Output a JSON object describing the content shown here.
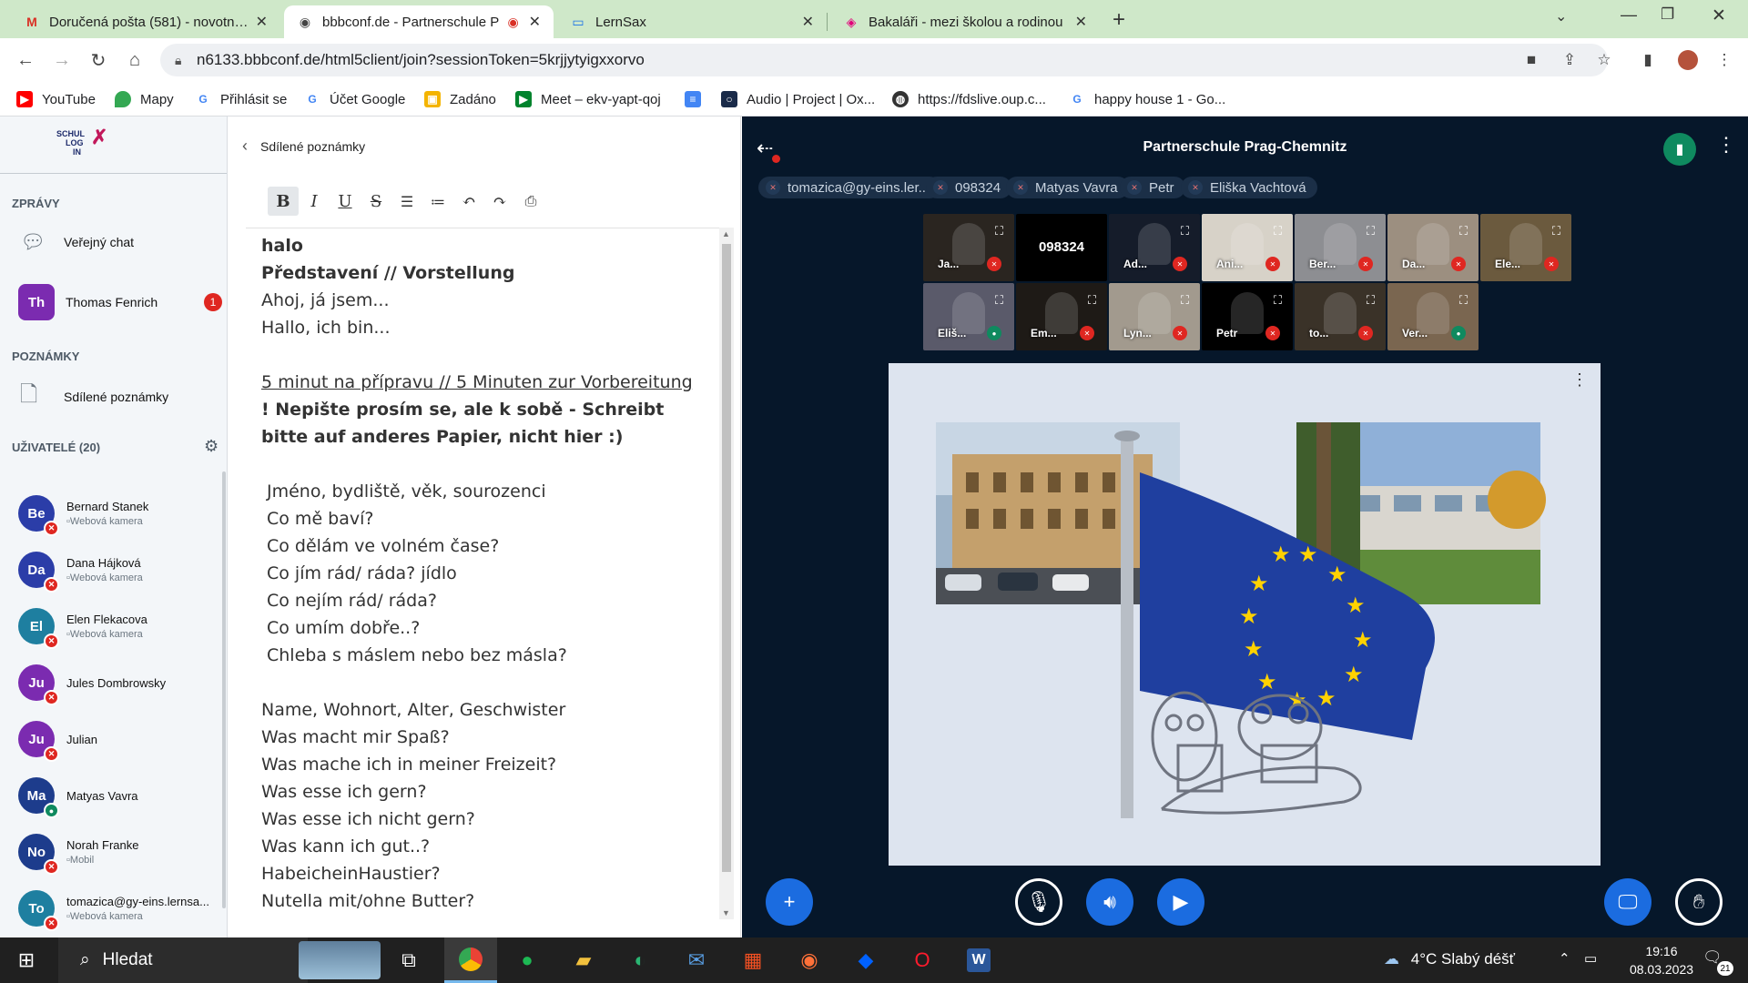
{
  "browser": {
    "tabs": [
      {
        "title": "Doručená pošta (581) - novotna.j",
        "icon": "gmail-icon"
      },
      {
        "title": "bbbconf.de - Partnerschule P",
        "icon": "bbb-icon",
        "active": true
      },
      {
        "title": "LernSax",
        "icon": "laptop-icon"
      },
      {
        "title": "Bakaláři - mezi školou a rodinou",
        "icon": "bakalari-icon"
      }
    ],
    "url": "n6133.bbbconf.de/html5client/join?sessionToken=5krjjytyigxxorvo",
    "bookmarks": [
      {
        "label": "YouTube",
        "icon": "youtube-icon",
        "color": "#ff0000"
      },
      {
        "label": "Mapy",
        "icon": "maps-icon",
        "color": "#34a853"
      },
      {
        "label": "Přihlásit se",
        "icon": "google-icon",
        "color": "#4285f4"
      },
      {
        "label": "Účet Google",
        "icon": "google-icon",
        "color": "#4285f4"
      },
      {
        "label": "Zadáno",
        "icon": "classroom-icon",
        "color": "#f4b400"
      },
      {
        "label": "Meet – ekv-yapt-qoj",
        "icon": "meet-icon",
        "color": "#00832d"
      },
      {
        "label": "Audio | Project | Ox...",
        "icon": "oxford-icon",
        "color": "#1a2b49"
      },
      {
        "label": "https://fdslive.oup.c...",
        "icon": "globe-icon",
        "color": "#333333"
      },
      {
        "label": "happy house 1 - Go...",
        "icon": "google-icon",
        "color": "#4285f4"
      }
    ]
  },
  "sidebar": {
    "logo_lines": [
      "SCHUL",
      "LOG",
      "IN"
    ],
    "messages_header": "ZPRÁVY",
    "public_chat": "Veřejný chat",
    "private_chat": {
      "initials": "Th",
      "name": "Thomas Fenrich",
      "unread": "1"
    },
    "notes_header": "POZNÁMKY",
    "shared_notes": "Sdílené poznámky",
    "users_header": "UŽIVATELÉ (20)",
    "users": [
      {
        "initials": "Be",
        "name": "Bernard Stanek",
        "sub": "Webová kamera",
        "color": "#2b3da8",
        "mic": "muted"
      },
      {
        "initials": "Da",
        "name": "Dana Hájková",
        "sub": "Webová kamera",
        "color": "#2b3da8",
        "mic": "muted"
      },
      {
        "initials": "El",
        "name": "Elen Flekacova",
        "sub": "Webová kamera",
        "color": "#1e7fa0",
        "mic": "muted"
      },
      {
        "initials": "Ju",
        "name": "Jules Dombrowsky",
        "sub": "",
        "color": "#7b2bb0",
        "mic": "muted"
      },
      {
        "initials": "Ju",
        "name": "Julian",
        "sub": "",
        "color": "#7b2bb0",
        "mic": "muted"
      },
      {
        "initials": "Ma",
        "name": "Matyas Vavra",
        "sub": "",
        "color": "#1d3c8c",
        "mic": "on"
      },
      {
        "initials": "No",
        "name": "Norah Franke",
        "sub": "Mobil",
        "color": "#1d3c8c",
        "mic": "muted"
      },
      {
        "initials": "To",
        "name": "tomazica@gy-eins.lernsa...",
        "sub": "Webová kamera",
        "color": "#1e7fa0",
        "mic": "muted"
      }
    ]
  },
  "notes": {
    "title": "Sdílené poznámky",
    "toolbar": [
      "bold-icon",
      "italic-icon",
      "underline-icon",
      "strikethrough-icon",
      "ordered-list-icon",
      "bullet-list-icon",
      "undo-icon",
      "redo-icon",
      "export-icon"
    ],
    "lines": [
      {
        "text": "halo",
        "style": "b"
      },
      {
        "text": "Představení // Vorstellung",
        "style": "b"
      },
      {
        "text": "Ahoj, já jsem...",
        "style": ""
      },
      {
        "text": "Hallo, ich bin...",
        "style": ""
      },
      {
        "text": "",
        "style": ""
      },
      {
        "text": "5 minut na přípravu // 5 Minuten zur Vorbereitung",
        "style": "u"
      },
      {
        "text": "! Nepište prosím se, ale k sobě - Schreibt",
        "style": "b"
      },
      {
        "text": "bitte auf anderes Papier, nicht hier :)",
        "style": "b"
      },
      {
        "text": "",
        "style": ""
      },
      {
        "text": "Jméno, bydliště, věk, sourozenci",
        "style": "ind"
      },
      {
        "text": "Co mě baví?",
        "style": "ind"
      },
      {
        "text": "Co dělám ve volném čase?",
        "style": "ind"
      },
      {
        "text": "Co jím rád/ ráda? jídlo",
        "style": "ind"
      },
      {
        "text": "Co nejím rád/ ráda?",
        "style": "ind"
      },
      {
        "text": "Co umím dobře..?",
        "style": "ind"
      },
      {
        "text": "Chleba s máslem nebo bez másla?",
        "style": "ind"
      },
      {
        "text": "",
        "style": ""
      },
      {
        "text": "Name, Wohnort, Alter, Geschwister",
        "style": ""
      },
      {
        "text": "Was macht mir Spaß?",
        "style": ""
      },
      {
        "text": "Was mache ich in meiner Freizeit?",
        "style": ""
      },
      {
        "text": "Was esse ich gern?",
        "style": ""
      },
      {
        "text": "Was esse ich nicht gern?",
        "style": ""
      },
      {
        "text": "Was kann ich gut..?",
        "style": ""
      },
      {
        "text": "HabeicheinHaustier?",
        "style": ""
      },
      {
        "text": "Nutella mit/ohne Butter?",
        "style": ""
      }
    ]
  },
  "meeting": {
    "title": "Partnerschule Prag-Chemnitz",
    "talkers": [
      "tomazica@gy-eins.ler...",
      "098324",
      "Matyas Vavra",
      "Petr",
      "Eliška Vachtová"
    ],
    "cams_row1": [
      {
        "name": "Ja...",
        "mic": "muted",
        "bg": "#2a2520",
        "text": ""
      },
      {
        "name": "",
        "mic": "none",
        "bg": "#000000",
        "text": "098324"
      },
      {
        "name": "Ad...",
        "mic": "muted",
        "bg": "#151c2a",
        "text": ""
      },
      {
        "name": "Ani...",
        "mic": "muted",
        "bg": "#d7d2c8",
        "text": ""
      },
      {
        "name": "Ber...",
        "mic": "muted",
        "bg": "#8d8e92",
        "text": ""
      },
      {
        "name": "Da...",
        "mic": "muted",
        "bg": "#9c8f80",
        "text": ""
      },
      {
        "name": "Ele...",
        "mic": "muted",
        "bg": "#6b5a3e",
        "text": ""
      }
    ],
    "cams_row2": [
      {
        "name": "Eliš...",
        "mic": "on",
        "bg": "#5a5a6a",
        "text": ""
      },
      {
        "name": "Em...",
        "mic": "muted",
        "bg": "#1e1a16",
        "text": ""
      },
      {
        "name": "Lyn...",
        "mic": "muted",
        "bg": "#a29a8e",
        "text": ""
      },
      {
        "name": "Petr",
        "mic": "muted",
        "bg": "#000000",
        "text": ""
      },
      {
        "name": "to...",
        "mic": "muted",
        "bg": "#3a3228",
        "text": ""
      },
      {
        "name": "Ver...",
        "mic": "on",
        "bg": "#7a6650",
        "text": ""
      }
    ],
    "controls": [
      "plus-icon",
      "mic-muted-icon",
      "speaker-icon",
      "video-icon",
      "screen-share-icon",
      "raise-hand-icon"
    ]
  },
  "taskbar": {
    "search": "Hledat",
    "weather": "4°C  Slabý déšť",
    "time": "19:16",
    "date": "08.03.2023",
    "notifications": "21"
  }
}
